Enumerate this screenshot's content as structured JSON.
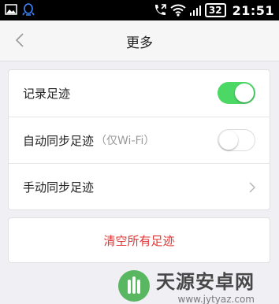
{
  "status_bar": {
    "battery_level": "32",
    "time": "21:51",
    "icons": [
      "image-icon",
      "qq-icon",
      "call-forward-icon",
      "wifi-icon",
      "signal-icon",
      "battery-icon"
    ]
  },
  "header": {
    "title": "更多",
    "back_icon": "chevron-left-icon"
  },
  "settings": {
    "rows": [
      {
        "label": "记录足迹",
        "control": "toggle",
        "state": "on"
      },
      {
        "label": "自动同步足迹",
        "hint": "（仅Wi-Fi）",
        "control": "toggle",
        "state": "off"
      },
      {
        "label": "手动同步足迹",
        "control": "chevron-right-icon"
      }
    ]
  },
  "clear_button": {
    "label": "清空所有足迹"
  },
  "watermark": {
    "main": "天源安卓网",
    "sub": "www.jytyaz.com"
  },
  "colors": {
    "toggle_on": "#4cd864",
    "danger": "#e03434",
    "page_bg": "#efeff4"
  }
}
